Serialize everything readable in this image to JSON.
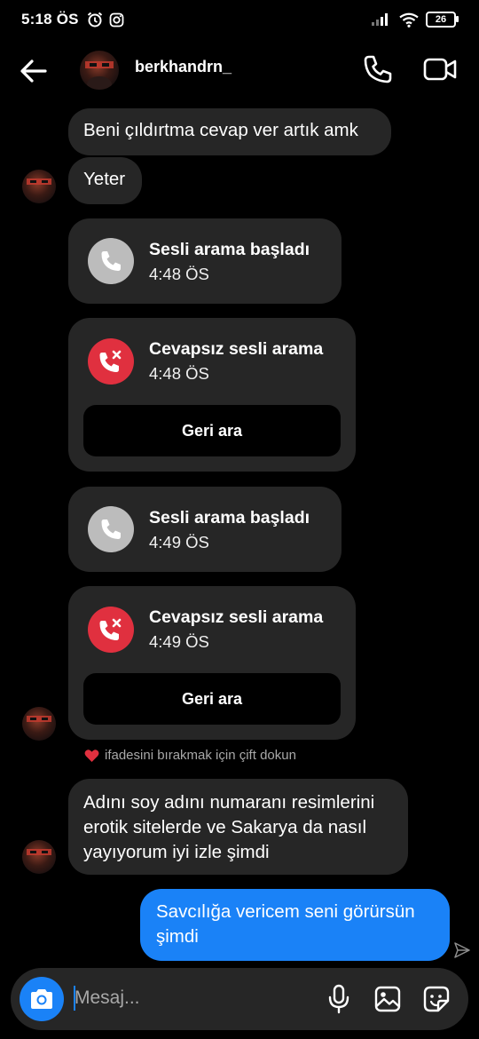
{
  "status_bar": {
    "time": "5:18 ÖS",
    "battery": "26"
  },
  "header": {
    "username": "berkhandrn_"
  },
  "messages": {
    "m1": "Beni çıldırtma cevap ver artık amk",
    "m2": "Yeter",
    "call1": {
      "title": "Sesli arama başladı",
      "time": "4:48 ÖS"
    },
    "call2": {
      "title": "Cevapsız sesli arama",
      "time": "4:48 ÖS",
      "button": "Geri ara"
    },
    "call3": {
      "title": "Sesli arama başladı",
      "time": "4:49 ÖS"
    },
    "call4": {
      "title": "Cevapsız sesli arama",
      "time": "4:49 ÖS",
      "button": "Geri ara"
    },
    "hint": "ifadesini bırakmak için çift dokun",
    "m3_lines": [
      "Adını soy adını numaranı resimlerini",
      "erotik sitelerde ve Sakarya da nasıl",
      "yayıyorum iyi izle şimdi"
    ],
    "out_lines": [
      "Savcılığa vericem seni görürsün",
      "şimdi"
    ]
  },
  "composer": {
    "placeholder": "Mesaj..."
  },
  "icons": {
    "back": "arrow-left-icon",
    "phone": "phone-icon",
    "video": "video-camera-icon",
    "call_started": "phone-icon",
    "call_missed": "missed-call-icon",
    "camera": "camera-icon",
    "mic": "microphone-icon",
    "gallery": "image-icon",
    "sticker": "sticker-icon",
    "send_status": "sent-arrow-icon",
    "heart": "heart-icon"
  },
  "colors": {
    "accent": "#1a82f7",
    "missed": "#e0303f",
    "bubble": "#262626",
    "background": "#000000"
  }
}
